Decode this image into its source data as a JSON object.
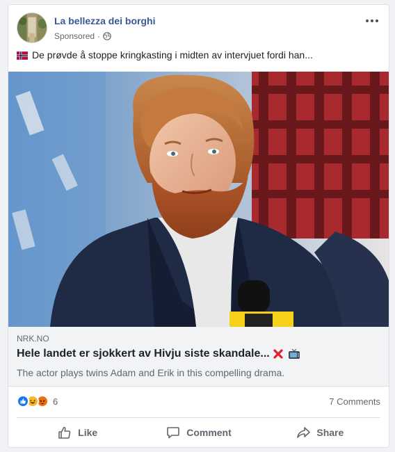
{
  "post": {
    "page_name": "La bellezza dei borghi",
    "sponsored": "Sponsored",
    "separator": "·",
    "text": "De prøvde å stoppe kringkasting i midten av intervjuet fordi han..."
  },
  "link": {
    "domain": "NRK.NO",
    "headline": "Hele landet er sjokkert av Hivju siste skandale...",
    "description": "The actor plays twins Adam and Erik in this compelling drama."
  },
  "stats": {
    "reactions_count": "6",
    "comments": "7 Comments"
  },
  "actions": {
    "like": "Like",
    "comment": "Comment",
    "share": "Share"
  },
  "icons": {
    "flag": "norway-flag-icon",
    "globe": "globe-icon",
    "more": "more-options-icon",
    "headline_emojis": [
      "cross-mark-icon",
      "television-icon"
    ],
    "reactions": [
      "like-icon",
      "haha-icon",
      "angry-icon"
    ]
  },
  "colors": {
    "page_name": "#385898",
    "like_blue": "#1877f2",
    "haha_yellow": "#f7b928",
    "angry_orange": "#e9710f",
    "link_box_bg": "#f2f3f5"
  }
}
